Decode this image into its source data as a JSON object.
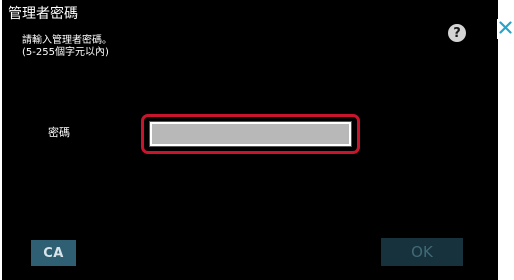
{
  "dialog": {
    "title": "管理者密碼",
    "instructions": {
      "line1": "請輸入管理者密碼。",
      "line2": "(5-255個字元以內)"
    },
    "help_label": "?",
    "password": {
      "label": "密碼",
      "value": ""
    },
    "ca_label": "CA",
    "ok_label": "OK"
  },
  "icons": {
    "help": "question-mark-icon",
    "close": "close-x-icon"
  },
  "colors": {
    "background": "#000000",
    "highlight_border": "#c8142d",
    "field_fill": "#b8b8b8",
    "ca_button": "#2e5f73",
    "ok_button_disabled": "#17323c",
    "close_icon": "#2aa3c9"
  }
}
